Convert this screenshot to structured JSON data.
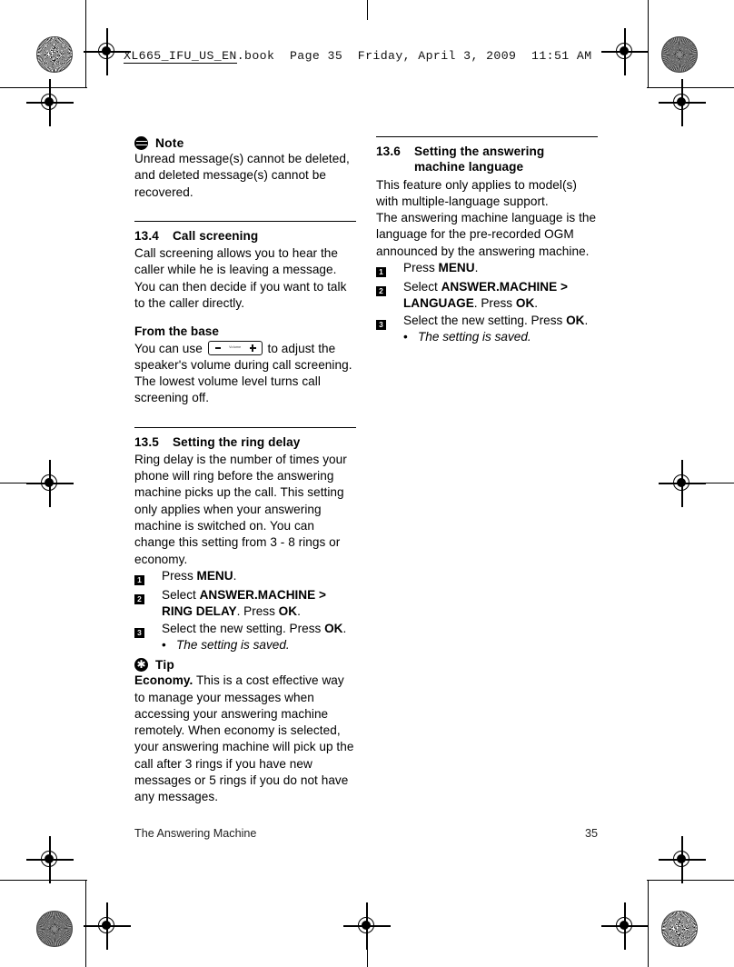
{
  "slug": {
    "file": "XL665_IFU_US_EN",
    "ext": ".book",
    "page": "Page 35",
    "date": "Friday, April 3, 2009",
    "time": "11:51 AM"
  },
  "left_column": {
    "note": {
      "icon": "note-icon",
      "label": "Note",
      "text": "Unread message(s) cannot be deleted, and deleted message(s) cannot be recovered."
    },
    "section_13_4": {
      "number": "13.4",
      "title": "Call screening",
      "paragraph": "Call screening allows you to hear the caller while he is leaving a message. You can then decide if you want to talk to the caller directly.",
      "subheading": "From the base",
      "body_before_key": "You can use",
      "key_label": "Volume",
      "body_after_key": "to adjust the speaker's volume during call screening. The lowest volume level turns call screening off."
    },
    "section_13_5": {
      "number": "13.5",
      "title": "Setting the ring delay",
      "paragraph": "Ring delay is the number of times your phone will ring before the answering machine picks up the call. This setting only applies when your answering machine is switched on. You can change this setting from 3 - 8 rings or economy.",
      "steps": [
        {
          "num": "1",
          "parts": [
            {
              "text": "Press ",
              "bold": false
            },
            {
              "text": "MENU",
              "bold": true
            },
            {
              "text": ".",
              "bold": false
            }
          ]
        },
        {
          "num": "2",
          "parts": [
            {
              "text": "Select ",
              "bold": false
            },
            {
              "text": "ANSWER.MACHINE > RING DELAY",
              "bold": true
            },
            {
              "text": ". Press ",
              "bold": false
            },
            {
              "text": "OK",
              "bold": true
            },
            {
              "text": ".",
              "bold": false
            }
          ]
        },
        {
          "num": "3",
          "parts": [
            {
              "text": "Select the new setting. Press ",
              "bold": false
            },
            {
              "text": "OK",
              "bold": true
            },
            {
              "text": ".",
              "bold": false
            }
          ],
          "sub": [
            {
              "bullet": "•",
              "text": "The setting is saved."
            }
          ]
        }
      ]
    },
    "tip": {
      "icon": "tip-icon",
      "label": "Tip",
      "lead": "Economy.",
      "text": " This is a cost effective way to manage your messages when accessing your answering machine remotely. When economy is selected, your answering machine will pick up the call after 3 rings if you have new messages or 5 rings if you do not have any messages."
    }
  },
  "right_column": {
    "section_13_6": {
      "number": "13.6",
      "title_line1": "Setting the answering",
      "title_line2": "machine language",
      "paragraph1": "This feature only applies to model(s) with multiple-language support.",
      "paragraph2": "The answering machine language is the language for the pre-recorded OGM announced by the answering machine.",
      "steps": [
        {
          "num": "1",
          "parts": [
            {
              "text": "Press ",
              "bold": false
            },
            {
              "text": "MENU",
              "bold": true
            },
            {
              "text": ".",
              "bold": false
            }
          ]
        },
        {
          "num": "2",
          "parts": [
            {
              "text": "Select ",
              "bold": false
            },
            {
              "text": "ANSWER.MACHINE > LANGUAGE",
              "bold": true
            },
            {
              "text": ". Press ",
              "bold": false
            },
            {
              "text": "OK",
              "bold": true
            },
            {
              "text": ".",
              "bold": false
            }
          ]
        },
        {
          "num": "3",
          "parts": [
            {
              "text": "Select the new setting. Press ",
              "bold": false
            },
            {
              "text": "OK",
              "bold": true
            },
            {
              "text": ".",
              "bold": false
            }
          ],
          "sub": [
            {
              "bullet": "•",
              "text": "The setting is saved."
            }
          ]
        }
      ]
    }
  },
  "footer": {
    "chapter": "The Answering Machine",
    "page_number": "35"
  },
  "colors": {
    "ink": "#000000",
    "paper": "#ffffff",
    "footer_text": "#222222"
  }
}
